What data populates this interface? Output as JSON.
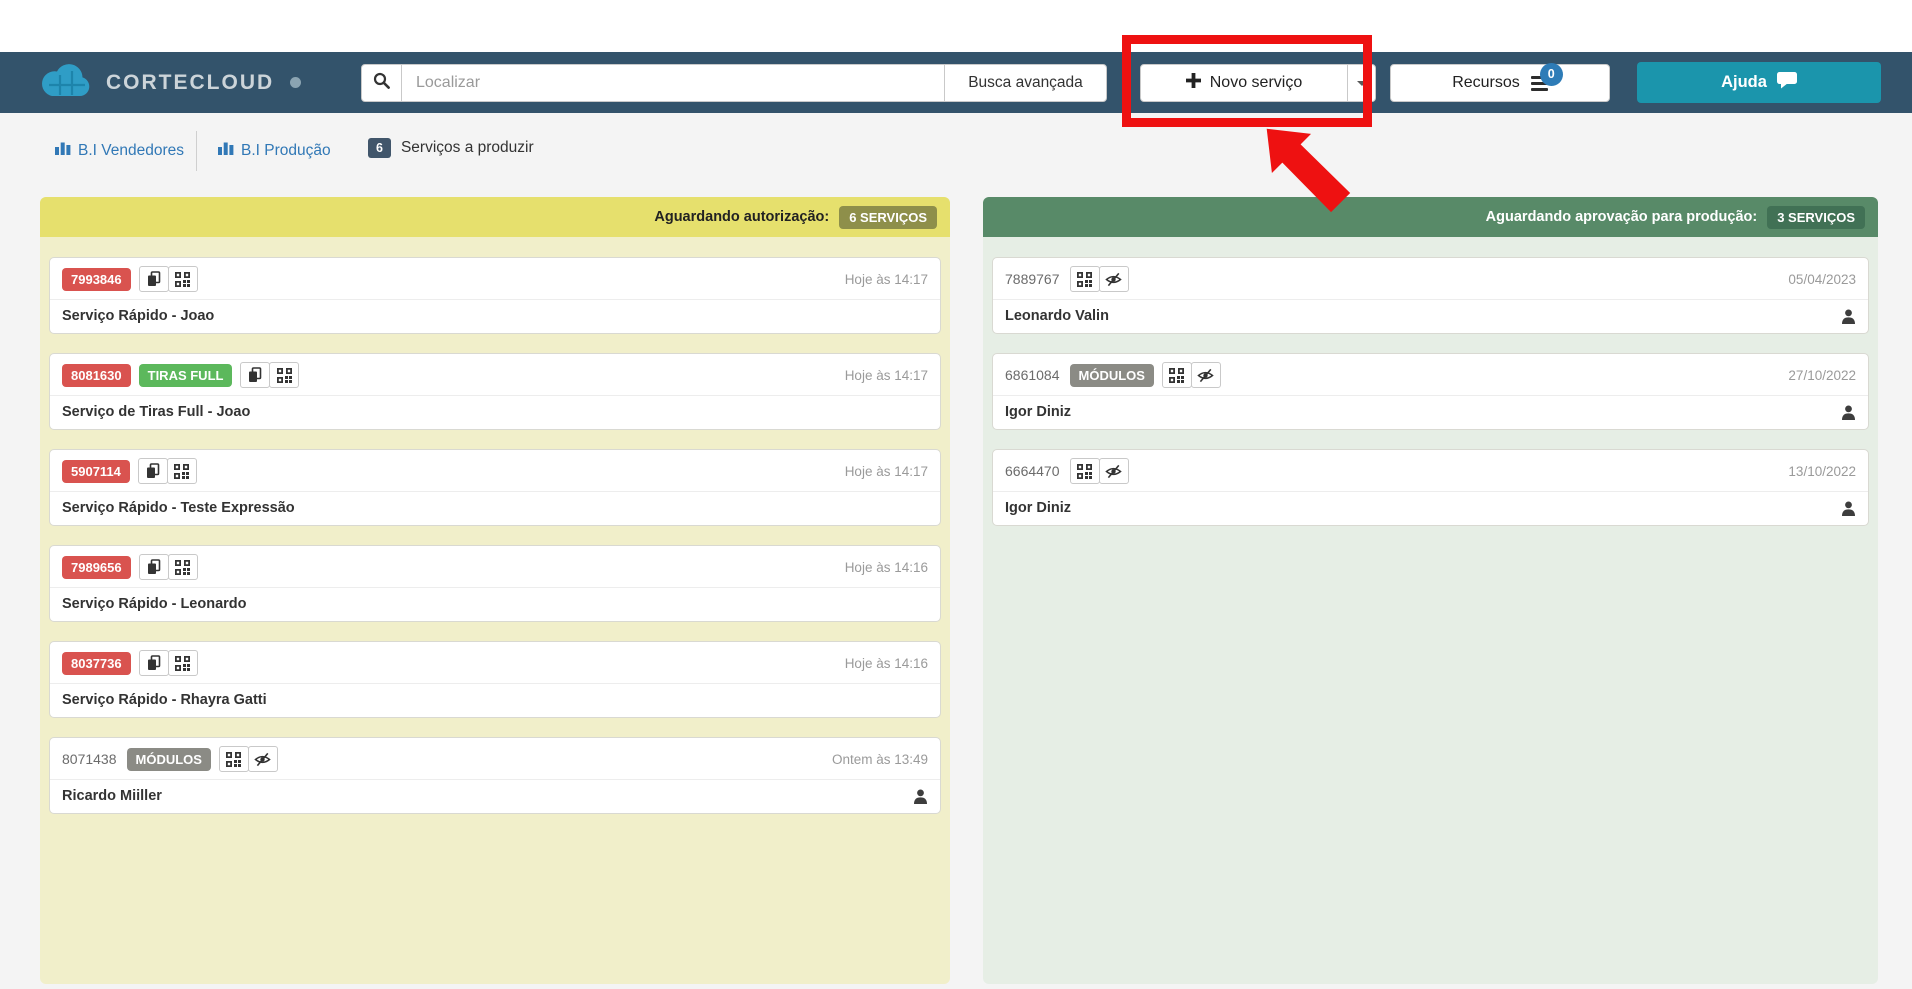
{
  "navbar": {
    "brand": "CORTECLOUD",
    "search_placeholder": "Localizar",
    "advanced_search_label": "Busca avançada",
    "new_service_label": "Novo serviço",
    "resources_label": "Recursos",
    "resources_badge": "0",
    "help_label": "Ajuda"
  },
  "tabs": {
    "bi_vendors_label": "B.I Vendedores",
    "bi_production_label": "B.I Produção",
    "services_badge": "6",
    "services_label": "Serviços a produzir"
  },
  "left_panel": {
    "header_label": "Aguardando autorização:",
    "header_badge": "6 SERVIÇOS",
    "cards": [
      {
        "number": "7993846",
        "number_style": "danger",
        "tag": "",
        "icons": [
          "copy",
          "qr"
        ],
        "time": "Hoje às 14:17",
        "title": "Serviço Rápido - Joao",
        "person": false
      },
      {
        "number": "8081630",
        "number_style": "danger",
        "tag": "TIRAS FULL",
        "tag_style": "success",
        "icons": [
          "copy",
          "qr"
        ],
        "time": "Hoje às 14:17",
        "title": "Serviço de Tiras Full - Joao",
        "person": false
      },
      {
        "number": "5907114",
        "number_style": "danger",
        "tag": "",
        "icons": [
          "copy",
          "qr"
        ],
        "time": "Hoje às 14:17",
        "title": "Serviço Rápido - Teste Expressão",
        "person": false
      },
      {
        "number": "7989656",
        "number_style": "danger",
        "tag": "",
        "icons": [
          "copy",
          "qr"
        ],
        "time": "Hoje às 14:16",
        "title": "Serviço Rápido - Leonardo",
        "person": false
      },
      {
        "number": "8037736",
        "number_style": "danger",
        "tag": "",
        "icons": [
          "copy",
          "qr"
        ],
        "time": "Hoje às 14:16",
        "title": "Serviço Rápido - Rhayra Gatti",
        "person": false
      },
      {
        "number": "8071438",
        "number_style": "plain",
        "tag": "MÓDULOS",
        "tag_style": "gray",
        "icons": [
          "qr",
          "eye"
        ],
        "time": "Ontem às 13:49",
        "title": "Ricardo Miiller",
        "person": true
      }
    ]
  },
  "right_panel": {
    "header_label": "Aguardando aprovação para produção:",
    "header_badge": "3 SERVIÇOS",
    "cards": [
      {
        "number": "7889767",
        "number_style": "plain",
        "tag": "",
        "icons": [
          "qr",
          "eye"
        ],
        "time": "05/04/2023",
        "title": "Leonardo Valin",
        "person": true
      },
      {
        "number": "6861084",
        "number_style": "plain",
        "tag": "MÓDULOS",
        "tag_style": "gray",
        "icons": [
          "qr",
          "eye"
        ],
        "time": "27/10/2022",
        "title": "Igor Diniz",
        "person": true
      },
      {
        "number": "6664470",
        "number_style": "plain",
        "tag": "",
        "icons": [
          "qr",
          "eye"
        ],
        "time": "13/10/2022",
        "title": "Igor Diniz",
        "person": true
      }
    ]
  },
  "annotations": {
    "highlight_target": "Novo serviço button",
    "shapes": [
      "red-box",
      "red-arrow"
    ]
  },
  "colors": {
    "page_bg": "#f4f4f4",
    "navbar": "#33536b",
    "teal": "#1b95ac",
    "link": "#3178b6",
    "danger": "#d9534f",
    "success": "#5cb85c",
    "gray_badge": "#8b8b85",
    "yellow_header": "#e6e06d",
    "yellow_body": "#f1efca",
    "olive_badge": "#8e8f4a",
    "green_header": "#588a68",
    "green_body": "#e6eee5",
    "green_badge": "#417155",
    "tab_badge": "#41566b",
    "resources_badge_blue": "#2e7cb7",
    "annotation_red": "#ee1111"
  }
}
